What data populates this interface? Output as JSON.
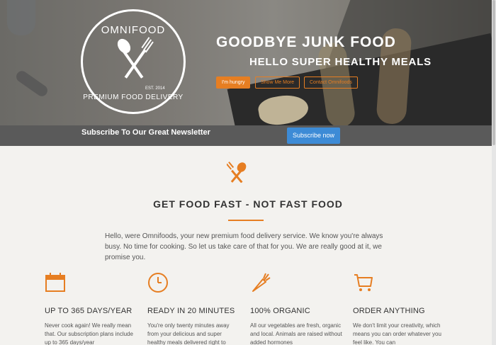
{
  "brand": {
    "logo_top": "OMNIFOOD",
    "logo_est": "EST. 2014",
    "logo_bottom": "PREMIUM FOOD DELIVERY"
  },
  "hero": {
    "title": "GOODBYE JUNK FOOD",
    "subtitle": "HELLO SUPER HEALTHY MEALS",
    "buttons": [
      "I'm hungry",
      "Show Me More",
      "Contact Omnifoods"
    ]
  },
  "newsletter": {
    "text": "Subscribe To Our Great Newsletter",
    "button": "Subscribe now"
  },
  "section": {
    "title": "GET FOOD FAST - NOT FAST FOOD",
    "intro": "Hello, were Omnifoods, your new premium food delivery service. We know you're always busy. No time for cooking. So let us take care of that for you. We are really good at it, we promise you."
  },
  "features": [
    {
      "icon": "calendar-icon",
      "title": "UP TO 365 DAYS/YEAR",
      "text": "Never cook again! We really mean that. Our subscription plans include up to 365 days/year"
    },
    {
      "icon": "clock-icon",
      "title": "READY IN 20 MINUTES",
      "text": "You're only twenty minutes away from your delicious and super healthy meals delivered right to"
    },
    {
      "icon": "carrot-icon",
      "title": "100% ORGANIC",
      "text": "All our vegetables are fresh, organic and local. Animals are raised without added hormones"
    },
    {
      "icon": "cart-icon",
      "title": "ORDER ANYTHING",
      "text": "We don't limit your creativity, which means you can order whatever you feel like. You can"
    }
  ],
  "colors": {
    "accent": "#e67e22",
    "newsletter_bg": "#5a5a5a",
    "subscribe_btn": "#3d8bd6"
  }
}
